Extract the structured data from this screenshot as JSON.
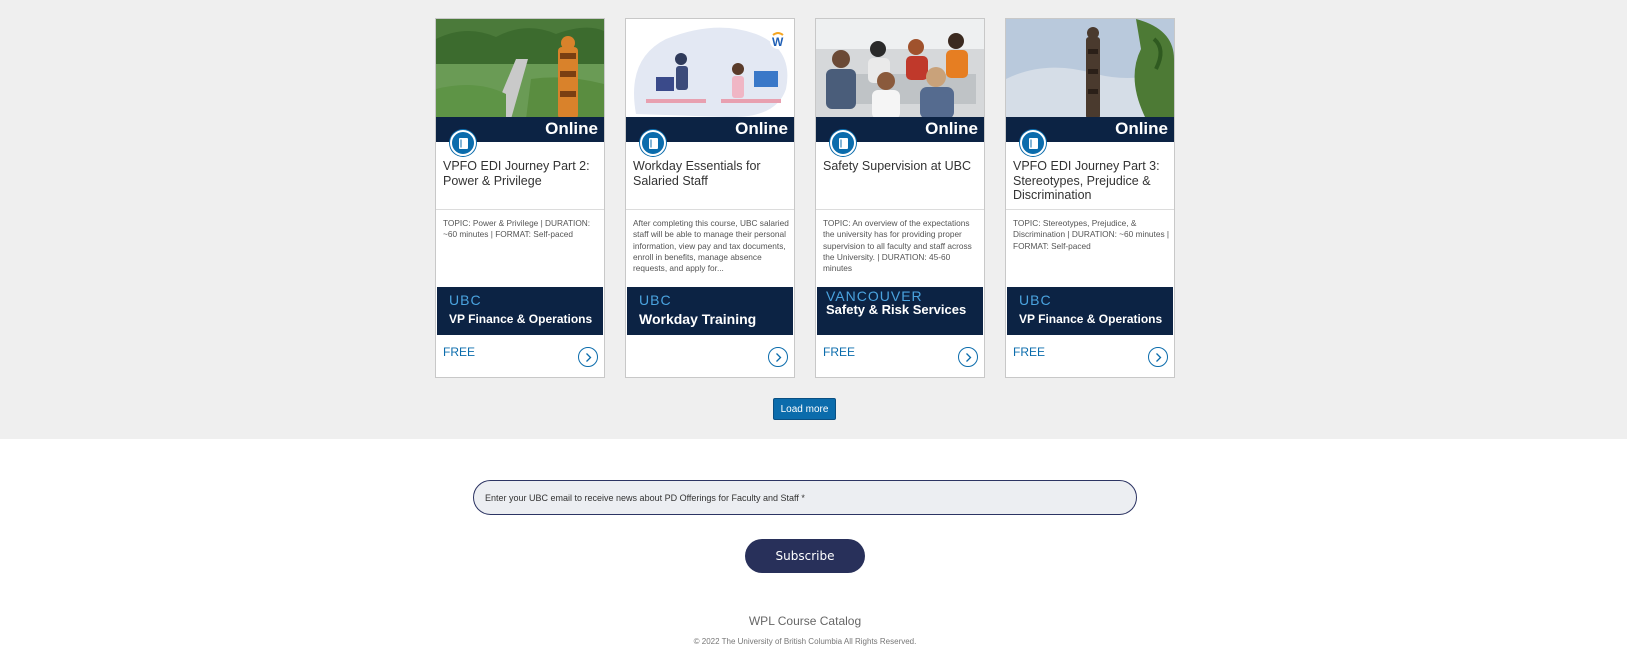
{
  "catalog": {
    "cards": [
      {
        "format": "Online",
        "title": "VPFO EDI Journey Part 2: Power & Privilege",
        "description": "TOPIC: Power & Privilege | DURATION: ~60 minutes | FORMAT: Self-paced",
        "provider_top": "UBC",
        "provider_bottom": "VP Finance & Operations",
        "price": "FREE"
      },
      {
        "format": "Online",
        "title": "Workday Essentials for Salaried Staff",
        "description": "After completing this course, UBC salaried staff will be able to manage their personal information, view pay and tax documents, enroll in benefits, manage absence requests, and apply for...",
        "provider_top": "UBC",
        "provider_bottom": "Workday Training",
        "price": ""
      },
      {
        "format": "Online",
        "title": "Safety Supervision at UBC",
        "description": "TOPIC: An overview of the expectations the university has for providing proper supervision to all faculty and staff across the University. | DURATION: 45-60 minutes",
        "provider_top": "VANCOUVER",
        "provider_bottom": "Safety & Risk Services",
        "price": "FREE"
      },
      {
        "format": "Online",
        "title": "VPFO EDI Journey Part 3: Stereotypes, Prejudice & Discrimination",
        "description": "TOPIC: Stereotypes, Prejudice, & Discrimination | DURATION: ~60 minutes | FORMAT: Self-paced",
        "provider_top": "UBC",
        "provider_bottom": "VP Finance & Operations",
        "price": "FREE"
      }
    ],
    "load_more_label": "Load more"
  },
  "newsletter": {
    "email_placeholder": "Enter your UBC email to receive news about PD Offerings for Faculty and Staff *",
    "subscribe_label": "Subscribe"
  },
  "footer": {
    "title": "WPL Course Catalog",
    "copyright": "© 2022 The University of British Columbia All Rights Reserved."
  },
  "colors": {
    "accent": "#0b6cac",
    "navy": "#0c2344",
    "subscribe": "#28305a",
    "band": "#efefef"
  },
  "icons": {
    "type_badge": "book-icon",
    "card_arrow": "chevron-right-icon",
    "workday_logo": "workday-logo-icon"
  }
}
